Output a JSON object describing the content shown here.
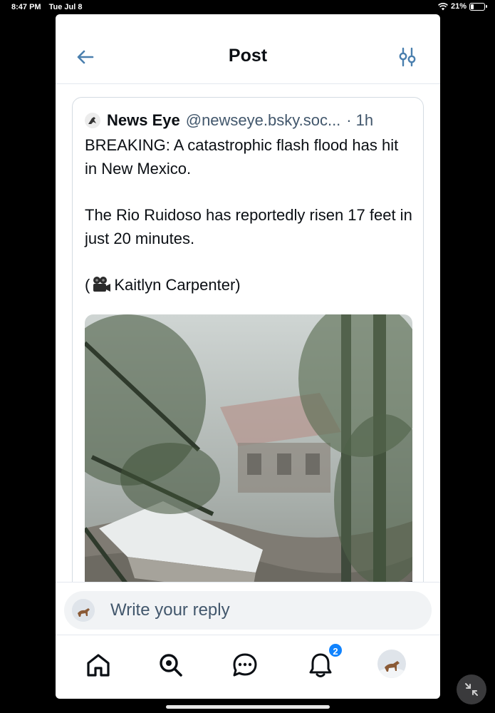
{
  "status_bar": {
    "time": "8:47 PM",
    "date": "Tue Jul 8",
    "battery_percent": "21%",
    "battery_level": 0.21,
    "wifi_icon": "wifi-icon"
  },
  "header": {
    "title": "Post",
    "back_icon": "arrow-left-icon",
    "filter_icon": "sliders-icon"
  },
  "post": {
    "author": "News Eye",
    "handle": "@newseye.bsky.soc...",
    "separator": "·",
    "time": "1h",
    "paragraphs": [
      "BREAKING: A catastrophic flash flood has hit in New Mexico.",
      "The Rio Ruidoso has reportedly risen 17 feet in just 20 minutes."
    ],
    "credit_open": "(",
    "credit_name": "Kaitlyn Carpenter)",
    "credit_icon": "movie-camera-icon"
  },
  "reply": {
    "placeholder": "Write your reply"
  },
  "nav": {
    "items": [
      "home-icon",
      "search-icon",
      "chat-icon",
      "bell-icon",
      "profile-avatar"
    ],
    "notification_count": "2"
  },
  "colors": {
    "accent": "#1083fe",
    "icon_blue": "#4a7fae",
    "text_primary": "#0b0f14",
    "text_secondary": "#42576c"
  }
}
